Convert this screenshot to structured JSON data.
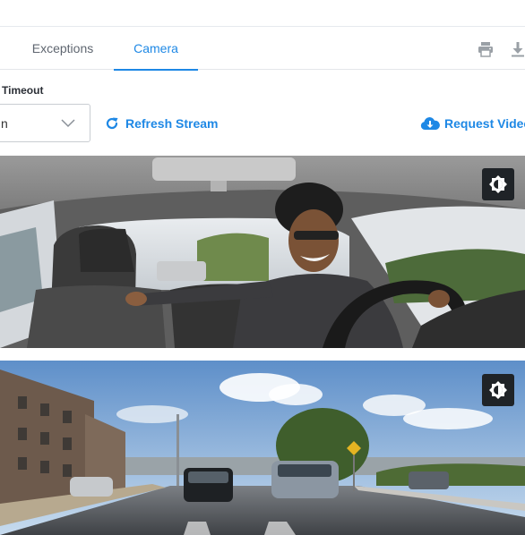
{
  "tabs": [
    {
      "label": "Exceptions",
      "active": false
    },
    {
      "label": "Camera",
      "active": true
    }
  ],
  "toolbar": {
    "print_icon": "print-icon",
    "download_icon": "download-icon"
  },
  "timeout": {
    "label": "Timeout",
    "selected_value": "n"
  },
  "actions": {
    "refresh_label": "Refresh Stream",
    "request_label": "Request Video"
  },
  "cameras": [
    {
      "view": "inward-cabin",
      "control_icon": "brightness-icon"
    },
    {
      "view": "outward-road",
      "control_icon": "brightness-icon"
    }
  ],
  "colors": {
    "accent": "#1e88e5",
    "tab_inactive": "#5f6670",
    "control_bg": "#1f2327"
  }
}
